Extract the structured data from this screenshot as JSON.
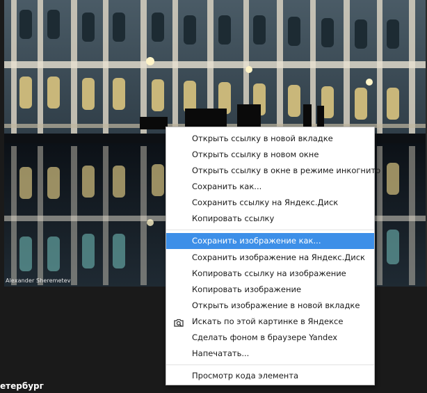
{
  "photo": {
    "credit": "Alexander Sheremetev"
  },
  "caption": "етербург",
  "context_menu": {
    "group1": [
      "Открыть ссылку в новой вкладке",
      "Открыть ссылку в новом окне",
      "Открыть ссылку в окне в режиме инкогнито",
      "Сохранить как...",
      "Сохранить ссылку на Яндекс.Диск",
      "Копировать ссылку"
    ],
    "group2": [
      "Сохранить изображение как...",
      "Сохранить изображение на Яндекс.Диск",
      "Копировать ссылку на изображение",
      "Копировать изображение",
      "Открыть изображение в новой вкладке",
      "Искать по этой картинке в Яндексе",
      "Сделать фоном в браузере Yandex",
      "Напечатать..."
    ],
    "group3": [
      "Просмотр кода элемента"
    ],
    "highlighted_item": "Сохранить изображение как...",
    "highlight_color": "#3d8fe8",
    "search_icon": "camera-search-icon"
  }
}
